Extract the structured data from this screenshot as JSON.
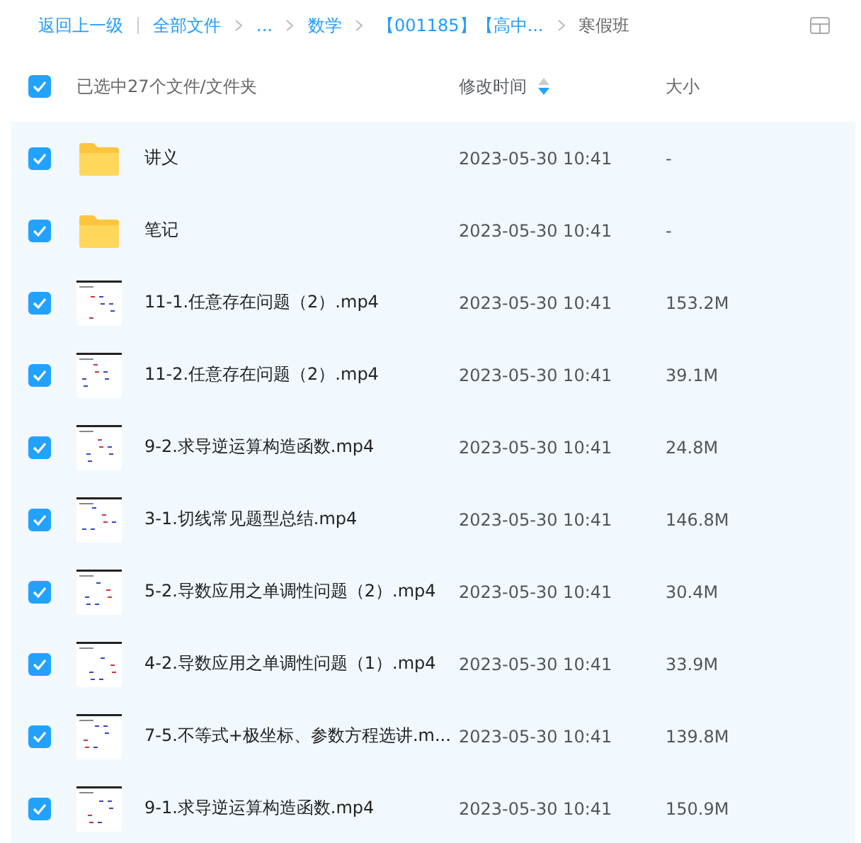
{
  "breadcrumb": {
    "back": "返回上一级",
    "items": [
      {
        "label": "全部文件",
        "current": false
      },
      {
        "label": "...",
        "current": false
      },
      {
        "label": "数学",
        "current": false
      },
      {
        "label": "【001185】【高中...",
        "current": false
      },
      {
        "label": "寒假班",
        "current": true
      }
    ]
  },
  "header": {
    "selection": "已选中27个文件/文件夹",
    "checked": true,
    "columns": [
      {
        "label": "修改时间",
        "sortable": true
      },
      {
        "label": "大小",
        "sortable": false
      }
    ]
  },
  "files": [
    {
      "kind": "folder",
      "name": "讲义",
      "modified": "2023-05-30 10:41",
      "size": "-",
      "checked": true
    },
    {
      "kind": "folder",
      "name": "笔记",
      "modified": "2023-05-30 10:41",
      "size": "-",
      "checked": true
    },
    {
      "kind": "video",
      "name": "11-1.任意存在问题（2）.mp4",
      "modified": "2023-05-30 10:41",
      "size": "153.2M",
      "checked": true
    },
    {
      "kind": "video",
      "name": "11-2.任意存在问题（2）.mp4",
      "modified": "2023-05-30 10:41",
      "size": "39.1M",
      "checked": true
    },
    {
      "kind": "video",
      "name": "9-2.求导逆运算构造函数.mp4",
      "modified": "2023-05-30 10:41",
      "size": "24.8M",
      "checked": true
    },
    {
      "kind": "video",
      "name": "3-1.切线常见题型总结.mp4",
      "modified": "2023-05-30 10:41",
      "size": "146.8M",
      "checked": true
    },
    {
      "kind": "video",
      "name": "5-2.导数应用之单调性问题（2）.mp4",
      "modified": "2023-05-30 10:41",
      "size": "30.4M",
      "checked": true
    },
    {
      "kind": "video",
      "name": "4-2.导数应用之单调性问题（1）.mp4",
      "modified": "2023-05-30 10:41",
      "size": "33.9M",
      "checked": true
    },
    {
      "kind": "video",
      "name": "7-5.不等式+极坐标、参数方程选讲.m...",
      "modified": "2023-05-30 10:41",
      "size": "139.8M",
      "checked": true
    },
    {
      "kind": "video",
      "name": "9-1.求导逆运算构造函数.mp4",
      "modified": "2023-05-30 10:41",
      "size": "150.9M",
      "checked": true
    }
  ]
}
